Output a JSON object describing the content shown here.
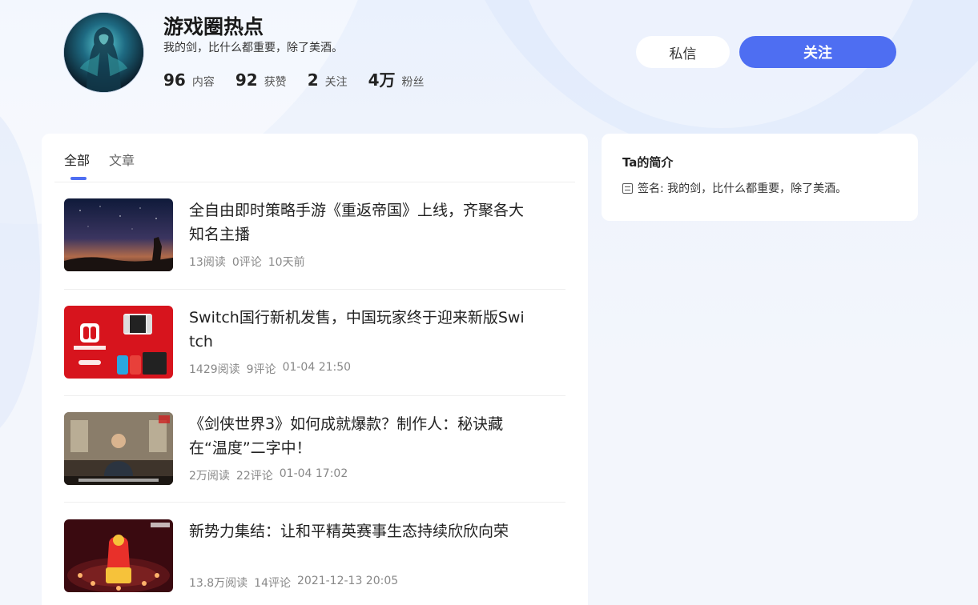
{
  "profile": {
    "name": "游戏圈热点",
    "bio": "我的剑，比什么都重要，除了美酒。",
    "stats": [
      {
        "num": "96",
        "label": "内容"
      },
      {
        "num": "92",
        "label": "获赞"
      },
      {
        "num": "2",
        "label": "关注"
      },
      {
        "num": "4万",
        "label": "粉丝"
      }
    ]
  },
  "actions": {
    "message_label": "私信",
    "follow_label": "关注",
    "follow_color": "#4e6ef2"
  },
  "tabs": [
    {
      "label": "全部",
      "active": true
    },
    {
      "label": "文章",
      "active": false
    }
  ],
  "articles": [
    {
      "title": "全自由即时策略手游《重返帝国》上线，齐聚各大知名主播",
      "reads": "13阅读",
      "comments": "0评论",
      "time": "10天前"
    },
    {
      "title": "Switch国行新机发售，中国玩家终于迎来新版Switch",
      "reads": "1429阅读",
      "comments": "9评论",
      "time": "01-04 21:50"
    },
    {
      "title": "《剑侠世界3》如何成就爆款？制作人：秘诀藏在“温度”二字中！",
      "reads": "2万阅读",
      "comments": "22评论",
      "time": "01-04 17:02"
    },
    {
      "title": "新势力集结：让和平精英赛事生态持续欣欣向荣",
      "reads": "13.8万阅读",
      "comments": "14评论",
      "time": "2021-12-13 20:05"
    }
  ],
  "sidebar": {
    "title": "Ta的简介",
    "sign": "签名: 我的剑，比什么都重要，除了美酒。"
  }
}
